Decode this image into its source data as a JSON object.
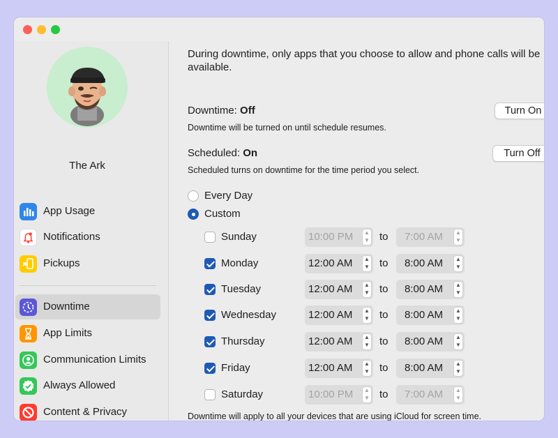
{
  "window": {
    "traffic_lights": [
      "close",
      "minimize",
      "zoom"
    ]
  },
  "sidebar": {
    "profile_name": "The Ark",
    "items_top": [
      {
        "label": "App Usage",
        "icon": "app-usage-icon",
        "color": "#2f86e9"
      },
      {
        "label": "Notifications",
        "icon": "notifications-bell-icon",
        "color": "#ff3b30"
      },
      {
        "label": "Pickups",
        "icon": "pickups-icon",
        "color": "#ffcc00"
      }
    ],
    "items_bottom": [
      {
        "label": "Downtime",
        "icon": "downtime-icon",
        "color": "#5b57d6",
        "selected": true
      },
      {
        "label": "App Limits",
        "icon": "hourglass-icon",
        "color": "#ff9500"
      },
      {
        "label": "Communication Limits",
        "icon": "communication-limits-icon",
        "color": "#34c759"
      },
      {
        "label": "Always Allowed",
        "icon": "checkmark-badge-icon",
        "color": "#34c759"
      },
      {
        "label": "Content & Privacy",
        "icon": "restriction-icon",
        "color": "#ff3b30"
      }
    ]
  },
  "main": {
    "intro": "During downtime, only apps that you choose to allow and phone calls will be available.",
    "downtime": {
      "label": "Downtime:",
      "status": "Off",
      "description": "Downtime will be turned on until schedule resumes.",
      "button": "Turn On"
    },
    "scheduled": {
      "label": "Scheduled:",
      "status": "On",
      "description": "Scheduled turns on downtime for the time period you select.",
      "button": "Turn Off"
    },
    "schedule_options": [
      {
        "label": "Every Day",
        "selected": false
      },
      {
        "label": "Custom",
        "selected": true
      }
    ],
    "to_label": "to",
    "days": [
      {
        "day": "Sunday",
        "checked": false,
        "from": "10:00 PM",
        "to": "7:00 AM"
      },
      {
        "day": "Monday",
        "checked": true,
        "from": "12:00 AM",
        "to": "8:00 AM"
      },
      {
        "day": "Tuesday",
        "checked": true,
        "from": "12:00 AM",
        "to": "8:00 AM"
      },
      {
        "day": "Wednesday",
        "checked": true,
        "from": "12:00 AM",
        "to": "8:00 AM"
      },
      {
        "day": "Thursday",
        "checked": true,
        "from": "12:00 AM",
        "to": "8:00 AM"
      },
      {
        "day": "Friday",
        "checked": true,
        "from": "12:00 AM",
        "to": "8:00 AM"
      },
      {
        "day": "Saturday",
        "checked": false,
        "from": "10:00 PM",
        "to": "7:00 AM"
      }
    ],
    "footer": "Downtime will apply to all your devices that are using iCloud for screen time."
  },
  "colors": {
    "background": "#ccccf6",
    "accent": "#1e5ab4",
    "avatar_background": "#c9edcf"
  }
}
